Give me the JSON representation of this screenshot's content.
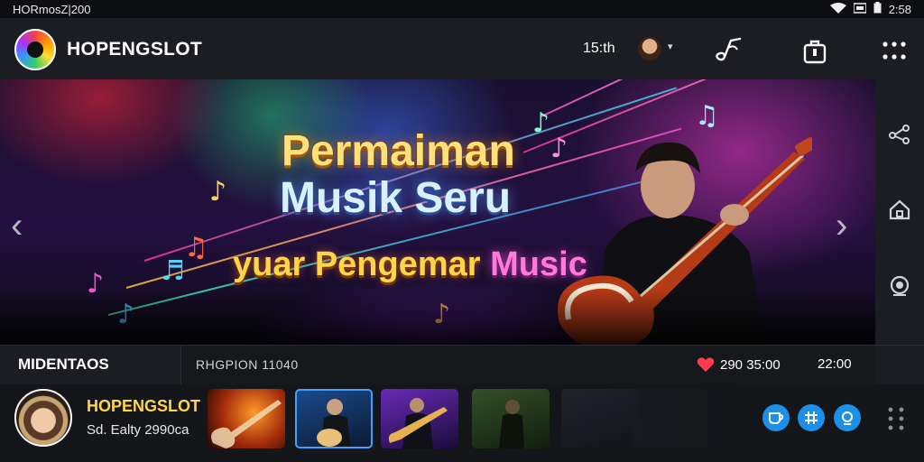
{
  "status": {
    "carrier": "HORmosZ|200",
    "time": "2:58"
  },
  "app": {
    "brand": "HOPENGSLOT",
    "time_ago": "15:th"
  },
  "hero": {
    "line1": "Permaiman",
    "line2": "Musik Seru",
    "line3_a": "yuar Pengemar",
    "line3_b": "Music"
  },
  "strip": {
    "label": "MIDENTAOS",
    "region": "RHGPION 11040",
    "likes": "290 35:00",
    "clock": "22:00"
  },
  "profile": {
    "name": "HOPENGSLOT",
    "sub": "Sd. Ealty 2990ca"
  },
  "colors": {
    "accent_blue": "#1e8fe6",
    "gold": "#ffd64a",
    "heart": "#ff3b4f"
  }
}
